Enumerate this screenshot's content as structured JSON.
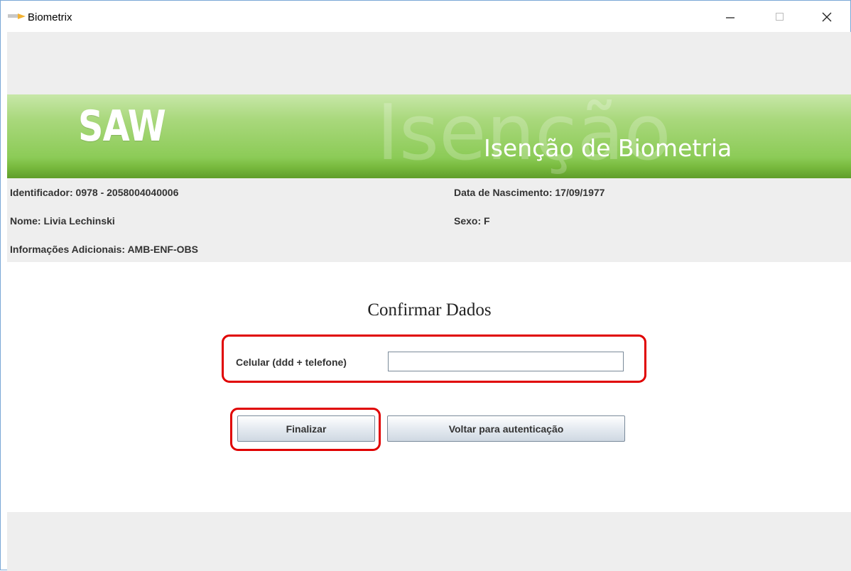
{
  "window": {
    "title": "Biometrix",
    "icon": "biometrix-app-icon",
    "controls": [
      "minimize-icon",
      "maximize-icon",
      "close-icon"
    ]
  },
  "banner": {
    "logo": "SAW",
    "background_word": "Isenção",
    "title": "Isenção de Biometria"
  },
  "patient": {
    "identificador": "Identificador: 0978 - 2058004040006",
    "nome": "Nome: Livia Lechinski",
    "informacoes": "Informações Adicionais: AMB-ENF-OBS",
    "nascimento": "Data de Nascimento: 17/09/1977",
    "sexo": "Sexo: F"
  },
  "form": {
    "heading": "Confirmar Dados",
    "phone_label": "Celular (ddd + telefone)",
    "phone_value": "",
    "finalizar_label": "Finalizar",
    "voltar_label": "Voltar para autenticação"
  },
  "colors": {
    "banner_green": "#8ccb57",
    "highlight_red": "#e00000",
    "panel_gray": "#eeeeee"
  }
}
